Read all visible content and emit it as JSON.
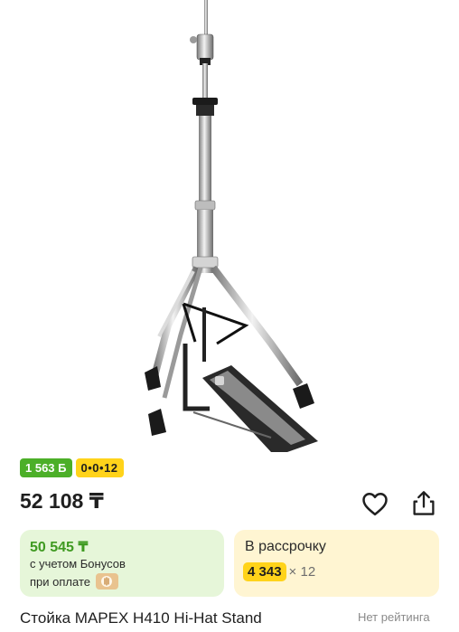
{
  "product": {
    "bonus_badge": "1 563 Б",
    "installment_badge": "0•0•12",
    "price": "52 108 ₸",
    "title": "Стойка MAPEX H410 Hi-Hat Stand",
    "rating": "Нет рейтинга"
  },
  "bonus_card": {
    "price": "50 545 ₸",
    "line1": "с учетом Бонусов",
    "line2": "при оплате"
  },
  "installment_card": {
    "title": "В рассрочку",
    "amount": "4 343",
    "months": "× 12"
  },
  "icons": [
    "heart-outline-icon",
    "share-icon",
    "payment-icon"
  ],
  "colors": {
    "bonus_green": "#4caf28",
    "bonus_text_green": "#3f9a21",
    "bonus_card_bg": "#e6f6d9",
    "installment_yellow": "#ffd31a",
    "installment_card_bg": "#fff5d2"
  }
}
